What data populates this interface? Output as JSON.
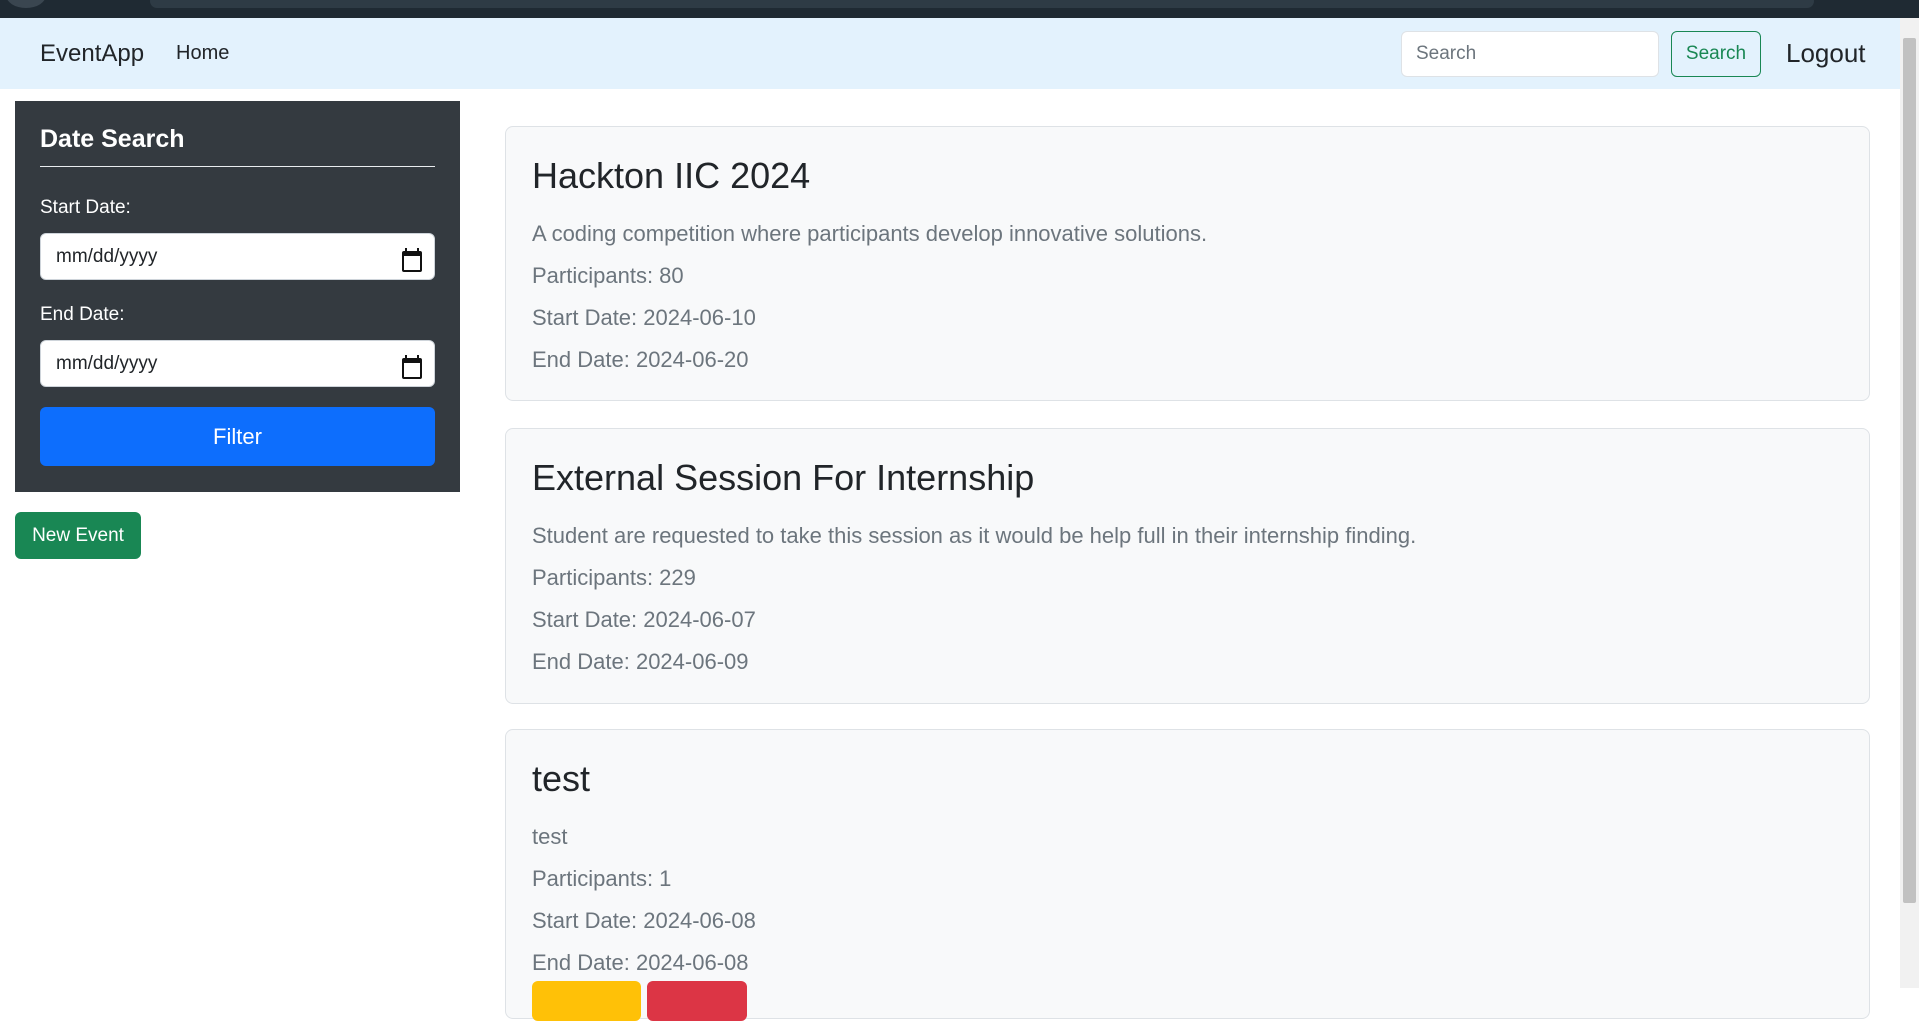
{
  "navbar": {
    "brand": "EventApp",
    "home_label": "Home",
    "search_placeholder": "Search",
    "search_button": "Search",
    "logout_label": "Logout",
    "background_color": "#e3f2fd"
  },
  "sidebar": {
    "title": "Date Search",
    "start_label": "Start Date:",
    "start_value": "mm/dd/yyyy",
    "end_label": "End Date:",
    "end_value": "mm/dd/yyyy",
    "filter_button": "Filter",
    "background_color": "#343a40"
  },
  "new_event_button": "New Event",
  "events": [
    {
      "title": "Hackton IIC 2024",
      "description": "A coding competition where participants develop innovative solutions.",
      "participants": "Participants: 80",
      "start": "Start Date: 2024-06-10",
      "end": "End Date: 2024-06-20"
    },
    {
      "title": "External Session For Internship",
      "description": "Student are requested to take this session as it would be help full in their internship finding.",
      "participants": "Participants: 229",
      "start": "Start Date: 2024-06-07",
      "end": "End Date: 2024-06-09"
    },
    {
      "title": "test",
      "description": "test",
      "participants": "Participants: 1",
      "start": "Start Date: 2024-06-08",
      "end": "End Date: 2024-06-08"
    }
  ],
  "colors": {
    "primary": "#0d6efd",
    "success": "#198754",
    "warning": "#ffc107",
    "danger": "#dc3545"
  }
}
